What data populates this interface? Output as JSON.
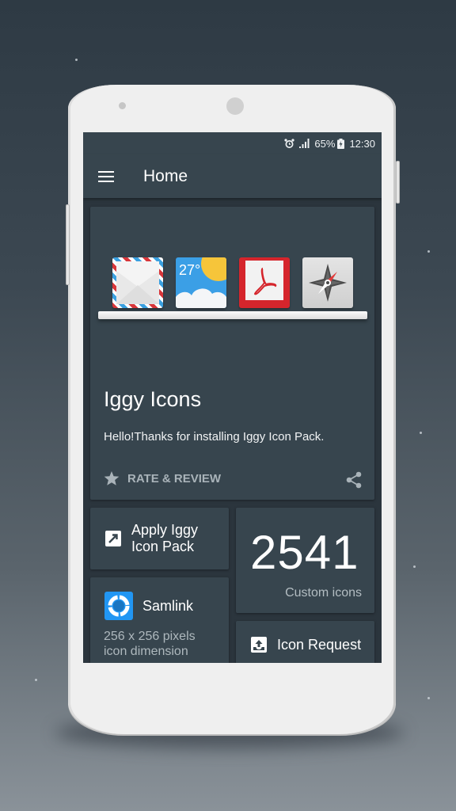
{
  "status_bar": {
    "alarm_icon": "alarm-clock-icon",
    "signal_icon": "signal-bars-icon",
    "battery_percent": "65%",
    "battery_icon": "battery-charging-icon",
    "time": "12:30"
  },
  "toolbar": {
    "menu_icon": "hamburger-menu-icon",
    "title": "Home"
  },
  "hero_card": {
    "showcase_icons": [
      "mail-envelope",
      "weather-27",
      "pdf-reader",
      "compass-browser"
    ],
    "weather_temp": "27°",
    "app_name": "Iggy Icons",
    "welcome_text": "Hello!Thanks for installing Iggy Icon Pack.",
    "rate_label": "RATE & REVIEW",
    "rate_icon": "star-icon",
    "share_icon": "share-icon"
  },
  "tiles": {
    "apply": {
      "icon": "apply-arrow-icon",
      "line1": "Apply Iggy",
      "line2": "Icon Pack"
    },
    "count": {
      "number": "2541",
      "label": "Custom icons"
    },
    "launcher": {
      "icon": "samlink-icon",
      "name": "Samlink",
      "line1": "256 x 256 pixels",
      "line2": "icon dimension"
    },
    "request": {
      "icon": "upload-tray-icon",
      "label": "Icon Request"
    }
  },
  "colors": {
    "card_bg": "#37454e",
    "screen_bg": "#2b353d",
    "accent_blue": "#2196f3"
  }
}
